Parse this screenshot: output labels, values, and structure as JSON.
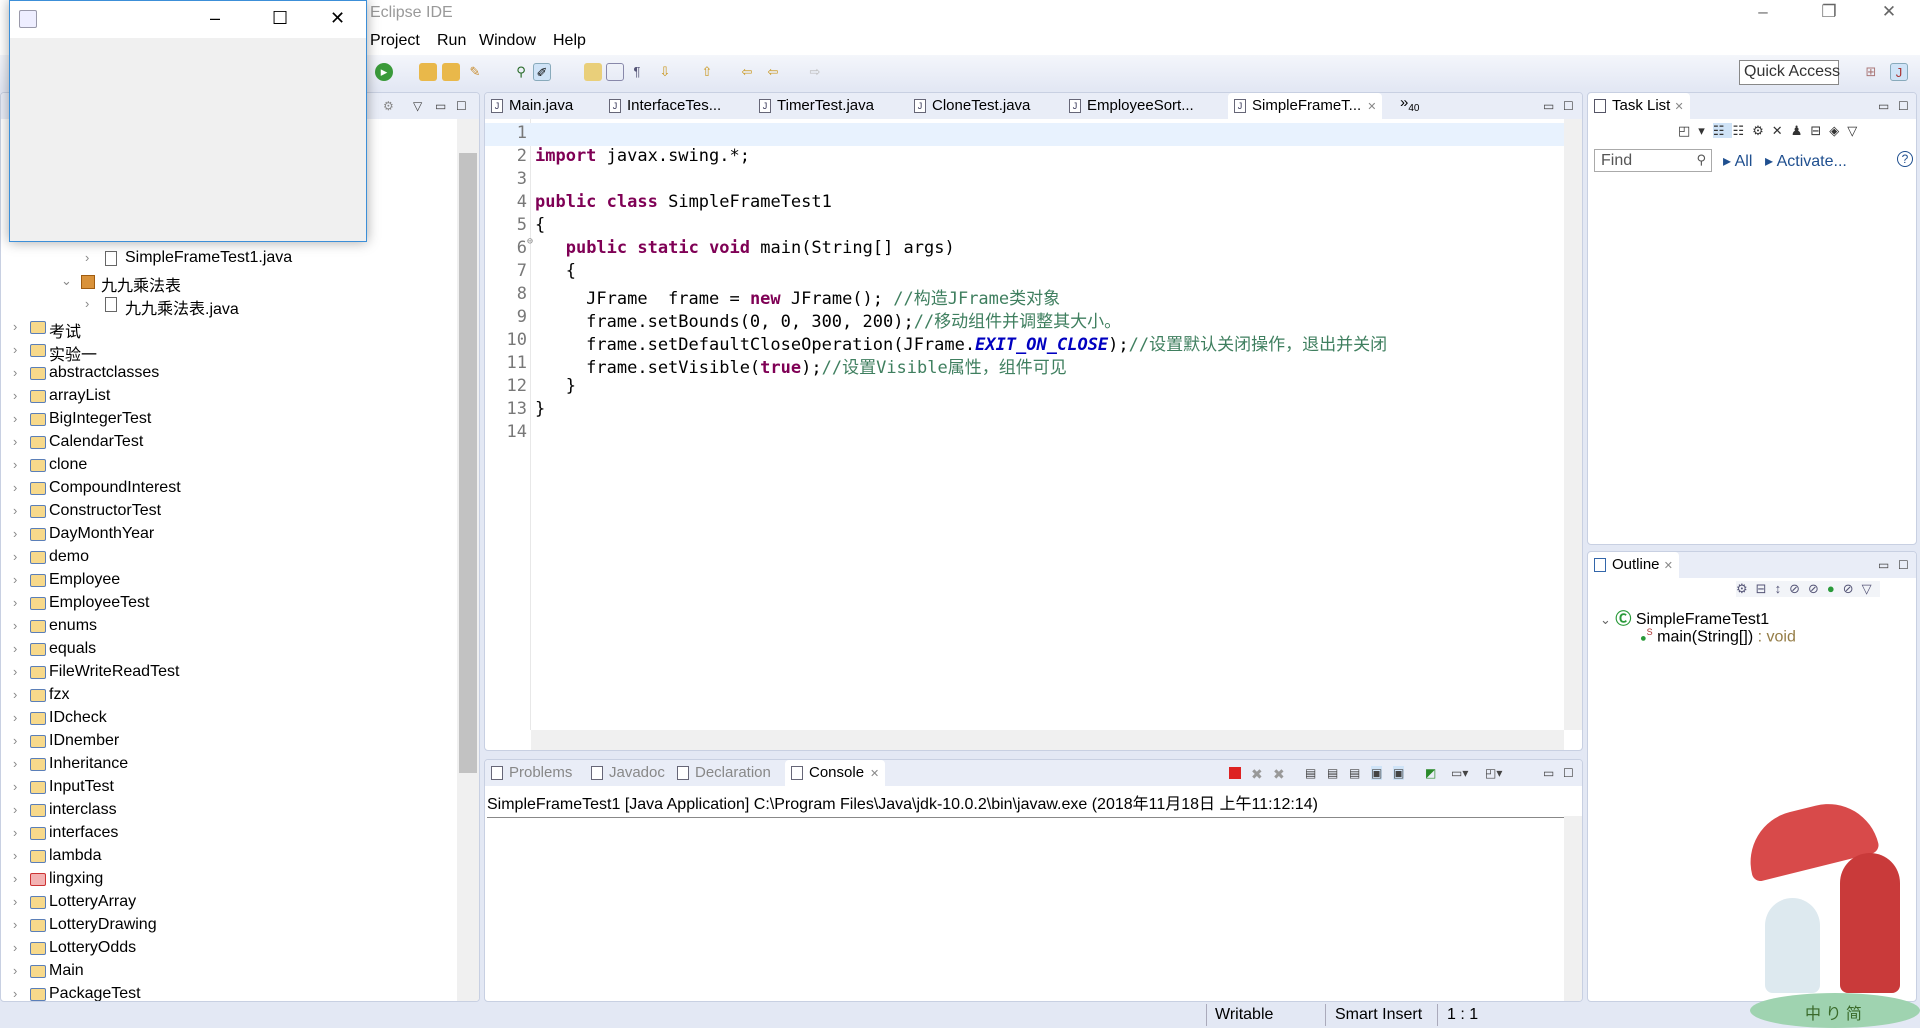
{
  "window": {
    "title": "Eclipse IDE",
    "min": "–",
    "max": "❐",
    "close": "✕"
  },
  "swing_frame": {
    "min": "–",
    "max": "☐",
    "close": "✕",
    "icon": "java-cup-icon"
  },
  "menu": [
    "Project",
    "Run",
    "Window",
    "Help"
  ],
  "toolbar": {
    "quick_access": "Quick Access"
  },
  "explorer": {
    "items": [
      {
        "label": "SimpleFrameTest1.java",
        "level": 3,
        "kind": "file"
      },
      {
        "label": "九九乘法表",
        "level": 2,
        "kind": "package",
        "expanded": true
      },
      {
        "label": "九九乘法表.java",
        "level": 3,
        "kind": "file"
      },
      {
        "label": "考试",
        "level": 0,
        "kind": "project"
      },
      {
        "label": "实验一",
        "level": 0,
        "kind": "project"
      },
      {
        "label": "abstractclasses",
        "level": 0,
        "kind": "project"
      },
      {
        "label": "arrayList",
        "level": 0,
        "kind": "project"
      },
      {
        "label": "BigIntegerTest",
        "level": 0,
        "kind": "project"
      },
      {
        "label": "CalendarTest",
        "level": 0,
        "kind": "project"
      },
      {
        "label": "clone",
        "level": 0,
        "kind": "project"
      },
      {
        "label": "CompoundInterest",
        "level": 0,
        "kind": "project"
      },
      {
        "label": "ConstructorTest",
        "level": 0,
        "kind": "project"
      },
      {
        "label": "DayMonthYear",
        "level": 0,
        "kind": "project"
      },
      {
        "label": "demo",
        "level": 0,
        "kind": "project"
      },
      {
        "label": "Employee",
        "level": 0,
        "kind": "project"
      },
      {
        "label": "EmployeeTest",
        "level": 0,
        "kind": "project"
      },
      {
        "label": "enums",
        "level": 0,
        "kind": "project"
      },
      {
        "label": "equals",
        "level": 0,
        "kind": "project"
      },
      {
        "label": "FileWriteReadTest",
        "level": 0,
        "kind": "project"
      },
      {
        "label": "fzx",
        "level": 0,
        "kind": "project"
      },
      {
        "label": "IDcheck",
        "level": 0,
        "kind": "project"
      },
      {
        "label": "IDnember",
        "level": 0,
        "kind": "project"
      },
      {
        "label": "Inheritance",
        "level": 0,
        "kind": "project"
      },
      {
        "label": "InputTest",
        "level": 0,
        "kind": "project"
      },
      {
        "label": "interclass",
        "level": 0,
        "kind": "project"
      },
      {
        "label": "interfaces",
        "level": 0,
        "kind": "project"
      },
      {
        "label": "lambda",
        "level": 0,
        "kind": "project"
      },
      {
        "label": "lingxing",
        "level": 0,
        "kind": "project-error"
      },
      {
        "label": "LotteryArray",
        "level": 0,
        "kind": "project"
      },
      {
        "label": "LotteryDrawing",
        "level": 0,
        "kind": "project"
      },
      {
        "label": "LotteryOdds",
        "level": 0,
        "kind": "project"
      },
      {
        "label": "Main",
        "level": 0,
        "kind": "project"
      },
      {
        "label": "PackageTest",
        "level": 0,
        "kind": "project"
      }
    ]
  },
  "editor": {
    "tabs": [
      {
        "label": "Main.java"
      },
      {
        "label": "InterfaceTes..."
      },
      {
        "label": "TimerTest.java"
      },
      {
        "label": "CloneTest.java"
      },
      {
        "label": "EmployeeSort..."
      },
      {
        "label": "SimpleFrameT...",
        "active": true
      }
    ],
    "overflow": "»",
    "overflow_count": "40",
    "lines": [
      [],
      [
        [
          "import",
          "kw"
        ],
        [
          " javax.swing.*;",
          ""
        ]
      ],
      [],
      [
        [
          "public",
          "kw"
        ],
        [
          " ",
          ""
        ],
        [
          "class",
          "kw"
        ],
        [
          " SimpleFrameTest1",
          ""
        ]
      ],
      [
        [
          "{",
          ""
        ]
      ],
      [
        [
          "   ",
          ""
        ],
        [
          "public",
          "kw"
        ],
        [
          " ",
          ""
        ],
        [
          "static",
          "kw"
        ],
        [
          " ",
          ""
        ],
        [
          "void",
          "kw"
        ],
        [
          " main(String[] args)",
          ""
        ]
      ],
      [
        [
          "   {",
          ""
        ]
      ],
      [
        [
          "     JFrame  frame = ",
          ""
        ],
        [
          "new",
          "kw"
        ],
        [
          " JFrame(); ",
          ""
        ],
        [
          "//构造JFrame类对象",
          "cm"
        ]
      ],
      [
        [
          "     frame.setBounds(0, 0, 300, 200);",
          ""
        ],
        [
          "//移动组件并调整其大小。",
          "cm"
        ]
      ],
      [
        [
          "     frame.setDefaultCloseOperation(JFrame.",
          ""
        ],
        [
          "EXIT_ON_CLOSE",
          "cst"
        ],
        [
          ");",
          ""
        ],
        [
          "//设置默认关闭操作，退出并关闭",
          "cm"
        ]
      ],
      [
        [
          "     frame.setVisible(",
          ""
        ],
        [
          "true",
          "kw"
        ],
        [
          ");",
          ""
        ],
        [
          "//设置Visible属性，组件可见",
          "cm"
        ]
      ],
      [
        [
          "   }",
          ""
        ]
      ],
      [
        [
          "}",
          ""
        ]
      ],
      []
    ]
  },
  "console": {
    "tabs": [
      {
        "label": "Problems"
      },
      {
        "label": "Javadoc"
      },
      {
        "label": "Declaration"
      },
      {
        "label": "Console",
        "active": true
      }
    ],
    "header": "SimpleFrameTest1 [Java Application] C:\\Program Files\\Java\\jdk-10.0.2\\bin\\javaw.exe (2018年11月18日 上午11:12:14)"
  },
  "tasklist": {
    "title": "Task List",
    "find_placeholder": "Find",
    "all": "All",
    "activate": "Activate...",
    "help": "?"
  },
  "outline": {
    "title": "Outline",
    "class_name": "SimpleFrameTest1",
    "method": "main(String[])",
    "method_type": " : void",
    "static_marker": "S"
  },
  "status": {
    "writable": "Writable",
    "insert_mode": "Smart Insert",
    "position": "1 : 1"
  },
  "watermark": "中 り 简"
}
